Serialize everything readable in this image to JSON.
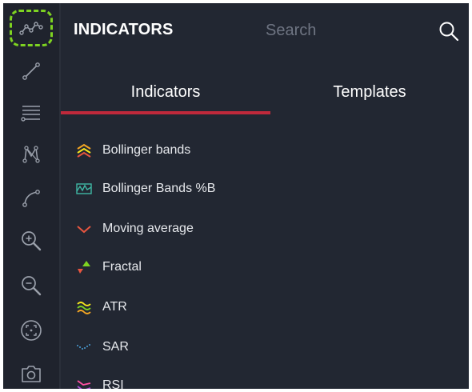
{
  "panel": {
    "title": "INDICATORS",
    "search_placeholder": "Search"
  },
  "tabs": [
    {
      "label": "Indicators",
      "active": true
    },
    {
      "label": "Templates",
      "active": false
    }
  ],
  "indicators": [
    {
      "label": "Bollinger bands",
      "icon": "bollinger-bands-icon"
    },
    {
      "label": "Bollinger Bands %B",
      "icon": "bollinger-percent-b-icon"
    },
    {
      "label": "Moving average",
      "icon": "moving-average-icon"
    },
    {
      "label": "Fractal",
      "icon": "fractal-icon"
    },
    {
      "label": "ATR",
      "icon": "atr-icon"
    },
    {
      "label": "SAR",
      "icon": "sar-icon"
    },
    {
      "label": "RSI",
      "icon": "rsi-icon"
    }
  ],
  "toolbar": {
    "tools": [
      {
        "icon": "indicators-icon",
        "active": true
      },
      {
        "icon": "trend-line-icon",
        "active": false
      },
      {
        "icon": "horizontal-lines-icon",
        "active": false
      },
      {
        "icon": "pattern-icon",
        "active": false
      },
      {
        "icon": "curve-icon",
        "active": false
      },
      {
        "icon": "zoom-in-icon",
        "active": false
      },
      {
        "icon": "zoom-out-icon",
        "active": false
      },
      {
        "icon": "fit-screen-icon",
        "active": false
      },
      {
        "icon": "camera-icon",
        "active": false
      }
    ]
  },
  "colors": {
    "accent": "#c0293b",
    "active_outline": "#7ed321",
    "background": "#222732"
  }
}
